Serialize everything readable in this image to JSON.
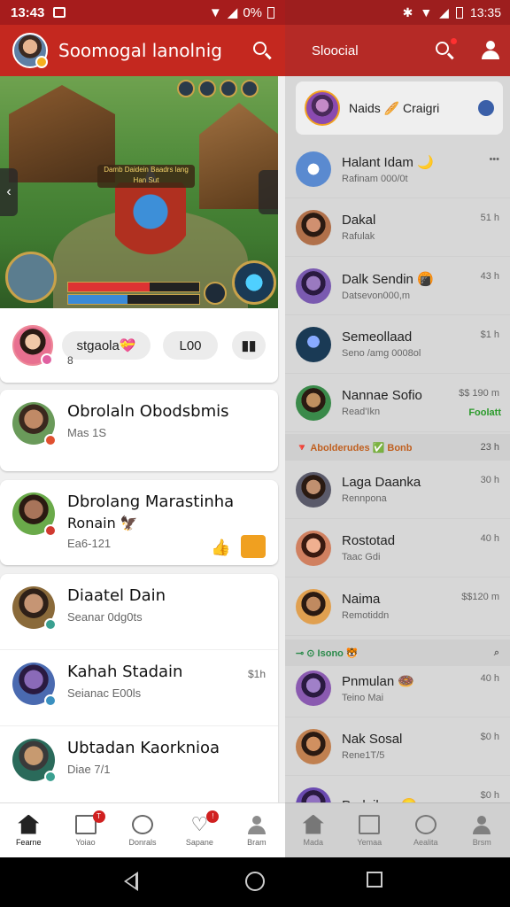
{
  "left": {
    "status": {
      "time": "13:43",
      "battery": "0%"
    },
    "appbar": {
      "title": "Soomogal lanolnig"
    },
    "share_card": {
      "pill1": "stgaola💝",
      "pill2": "L00",
      "sub": "8"
    },
    "chats": [
      {
        "name": "Obrolaln Obodsbmis",
        "msg": "Mas 1S",
        "time": "",
        "ring": "#e05030",
        "face": "#c08a66"
      },
      {
        "name": "Dbrolang Marastinha",
        "name2": "Ronain 🦅",
        "msg": "Ea6-121",
        "time": "",
        "ring": "#d03a30",
        "face": "#a8745a"
      },
      {
        "name": "Diaatel Dain",
        "msg": "Seanar 0dg0ts",
        "time": "",
        "ring": "#3aa090",
        "face": "#c69574"
      },
      {
        "name": "Kahah Stadain",
        "msg": "Seianac E00ls",
        "time": "$1h",
        "ring": "#3a90c0",
        "face": "#8a6ab8"
      },
      {
        "name": "Ubtadan Kaorknioa",
        "msg": "Diae 7/1",
        "time": "",
        "ring": "#3aa090",
        "face": "#c79a70"
      }
    ],
    "nav": [
      {
        "label": "Fearne",
        "icon": "home-icon",
        "active": true
      },
      {
        "label": "Yoiao",
        "icon": "book-icon",
        "badge": "T"
      },
      {
        "label": "Donrals",
        "icon": "compass-icon"
      },
      {
        "label": "Sapane",
        "icon": "heart-icon",
        "badge": "!"
      },
      {
        "label": "Bram",
        "icon": "profile-icon"
      }
    ],
    "game_banner": "Damb Daidein Baadrs lang Han Sut"
  },
  "right": {
    "status": {
      "time": "13:35"
    },
    "appbar": {
      "title": "Sloocial"
    },
    "top_card": {
      "label": "Naids 🥖 Craigri"
    },
    "rows": [
      {
        "name": "Halant Idam 🌙",
        "msg": "Rafinam 000/0t",
        "time": "•••",
        "face": "#5a8ad0"
      },
      {
        "name": "Dakal",
        "msg": "Rafulak",
        "time": "51 h",
        "face": "#b0704a"
      },
      {
        "name": "Dalk Sendin 🍘",
        "msg": "Datsevon000,m",
        "time": "43 h",
        "face": "#7a5ab0"
      },
      {
        "name": "Semeollaad",
        "msg": "Seno /amg 0008ol",
        "time": "$1 h",
        "face": "#3ac0e0"
      },
      {
        "name": "Nannae Sofio",
        "msg": "Read'Ikn",
        "time": "$$ 190 m",
        "extra": "Foolatt",
        "face": "#a0764a"
      }
    ],
    "section1": {
      "label": "🔻 Abolderudes ✅ Bonb",
      "time": "23 h"
    },
    "rows2": [
      {
        "name": "Laga Daanka",
        "msg": "Rennpona",
        "time": "30 h",
        "face": "#8a6a5a"
      },
      {
        "name": "Rostotad",
        "msg": "Taac Gdi",
        "time": "40 h",
        "face": "#d09070"
      },
      {
        "name": "Naima",
        "msg": "Remotiddn",
        "time": "$$120 m",
        "face": "#b07a50"
      }
    ],
    "section2": {
      "label": "⊸ ⊙ Isono 🐯",
      "time": ""
    },
    "rows3": [
      {
        "name": "Pnmulan 🍩",
        "msg": "Teino Mai",
        "time": "40 h",
        "face": "#8a5ab0"
      },
      {
        "name": "Nak Sosal",
        "msg": "Rene1T/5",
        "time": "$0 h",
        "face": "#c08050"
      },
      {
        "name": "Podeilam 😊",
        "msg": "",
        "time": "$0 h",
        "face": "#6a4ab0"
      }
    ],
    "nav": [
      {
        "label": "Mada",
        "icon": "home-icon"
      },
      {
        "label": "Yemaa",
        "icon": "book-icon"
      },
      {
        "label": "Aealita",
        "icon": "compass-icon"
      },
      {
        "label": "Brsm",
        "icon": "profile-icon"
      }
    ]
  },
  "colors": {
    "brand_red": "#c4281f",
    "status_red": "#a61c1c"
  }
}
